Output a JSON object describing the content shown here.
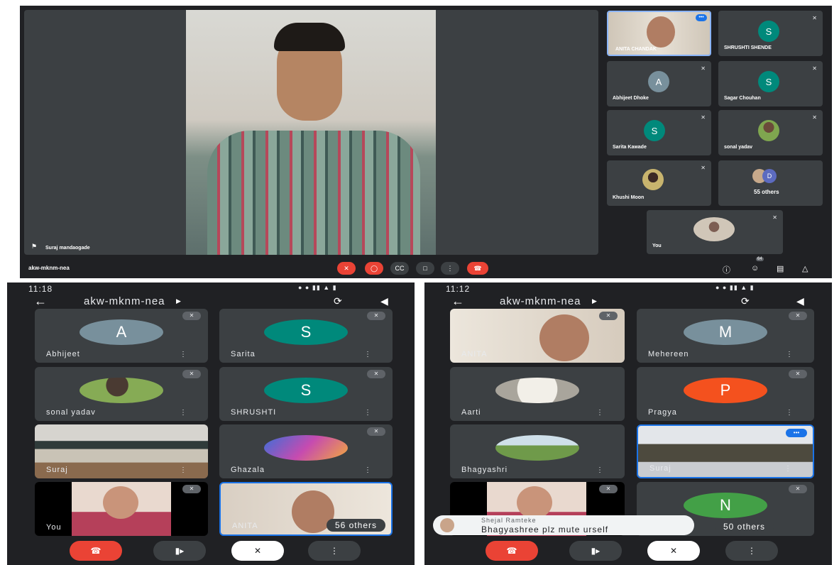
{
  "desktop": {
    "main_speaker": "Suraj mandaogade",
    "meeting_code": "akw-mknm-nea",
    "participant_count": "64",
    "tiles": [
      {
        "name": "ANITA CHANDAK",
        "initial": "",
        "color": ""
      },
      {
        "name": "SHRUSHTI SHENDE",
        "initial": "S",
        "color": "#00897b"
      },
      {
        "name": "Abhijeet Dhoke",
        "initial": "A",
        "color": "#78909c"
      },
      {
        "name": "Sagar Chouhan",
        "initial": "S",
        "color": "#00897b"
      },
      {
        "name": "Sarita Kawade",
        "initial": "S",
        "color": "#00897b"
      },
      {
        "name": "sonal yadav",
        "initial": "",
        "color": ""
      },
      {
        "name": "Khushi Moon",
        "initial": "",
        "color": ""
      },
      {
        "name": "55 others",
        "initial": "D",
        "color": "#5c6bc0"
      },
      {
        "name": "You",
        "initial": "",
        "color": ""
      }
    ]
  },
  "phone1": {
    "time": "11:18",
    "meeting_code": "akw-mknm-nea",
    "tiles": [
      {
        "name": "Abhijeet",
        "initial": "A",
        "color": "#78909c"
      },
      {
        "name": "Sarita",
        "initial": "S",
        "color": "#00897b"
      },
      {
        "name": "sonal yadav",
        "initial": "",
        "color": ""
      },
      {
        "name": "SHRUSHTI",
        "initial": "S",
        "color": "#00897b"
      },
      {
        "name": "Suraj",
        "initial": "",
        "color": ""
      },
      {
        "name": "Ghazala",
        "initial": "",
        "color": ""
      },
      {
        "name": "You",
        "initial": "",
        "color": ""
      },
      {
        "name": "ANITA",
        "initial": "",
        "color": ""
      }
    ],
    "others": "56 others"
  },
  "phone2": {
    "time": "11:12",
    "meeting_code": "akw-mknm-nea",
    "tiles": [
      {
        "name": "ANITA",
        "initial": "",
        "color": ""
      },
      {
        "name": "Mehereen",
        "initial": "M",
        "color": "#78909c"
      },
      {
        "name": "Aarti",
        "initial": "",
        "color": ""
      },
      {
        "name": "Pragya",
        "initial": "P",
        "color": "#f4511e"
      },
      {
        "name": "Bhagyashri",
        "initial": "",
        "color": ""
      },
      {
        "name": "Suraj",
        "initial": "",
        "color": ""
      },
      {
        "name": "",
        "initial": "",
        "color": ""
      },
      {
        "name": "50 others",
        "initial": "N",
        "color": "#43a047"
      }
    ],
    "toast": {
      "sender": "Shejal Ramteke",
      "message": "Bhagyashree plz mute urself"
    }
  },
  "colors": {
    "bg": "#202124",
    "tile": "#3c4043",
    "end_call": "#ea4335",
    "active_border": "#1a73e8"
  }
}
